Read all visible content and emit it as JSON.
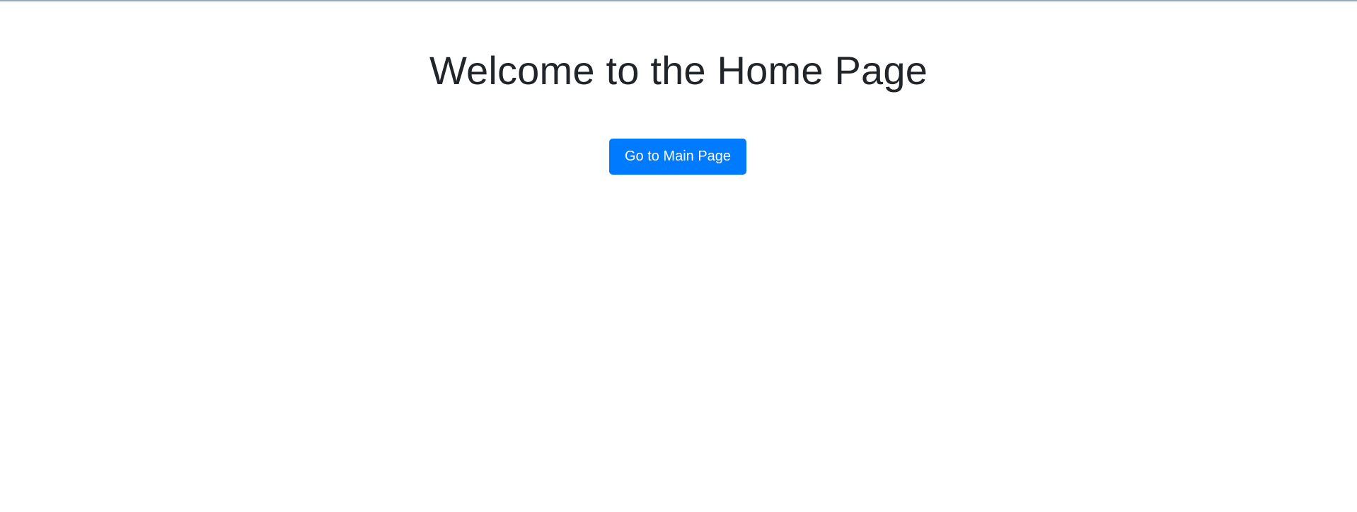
{
  "page": {
    "title": "Welcome to the Home Page"
  },
  "actions": {
    "main_page_button_label": "Go to Main Page"
  },
  "colors": {
    "primary": "#007bff",
    "heading": "#212529",
    "top_rule": "#9aa7c4"
  }
}
